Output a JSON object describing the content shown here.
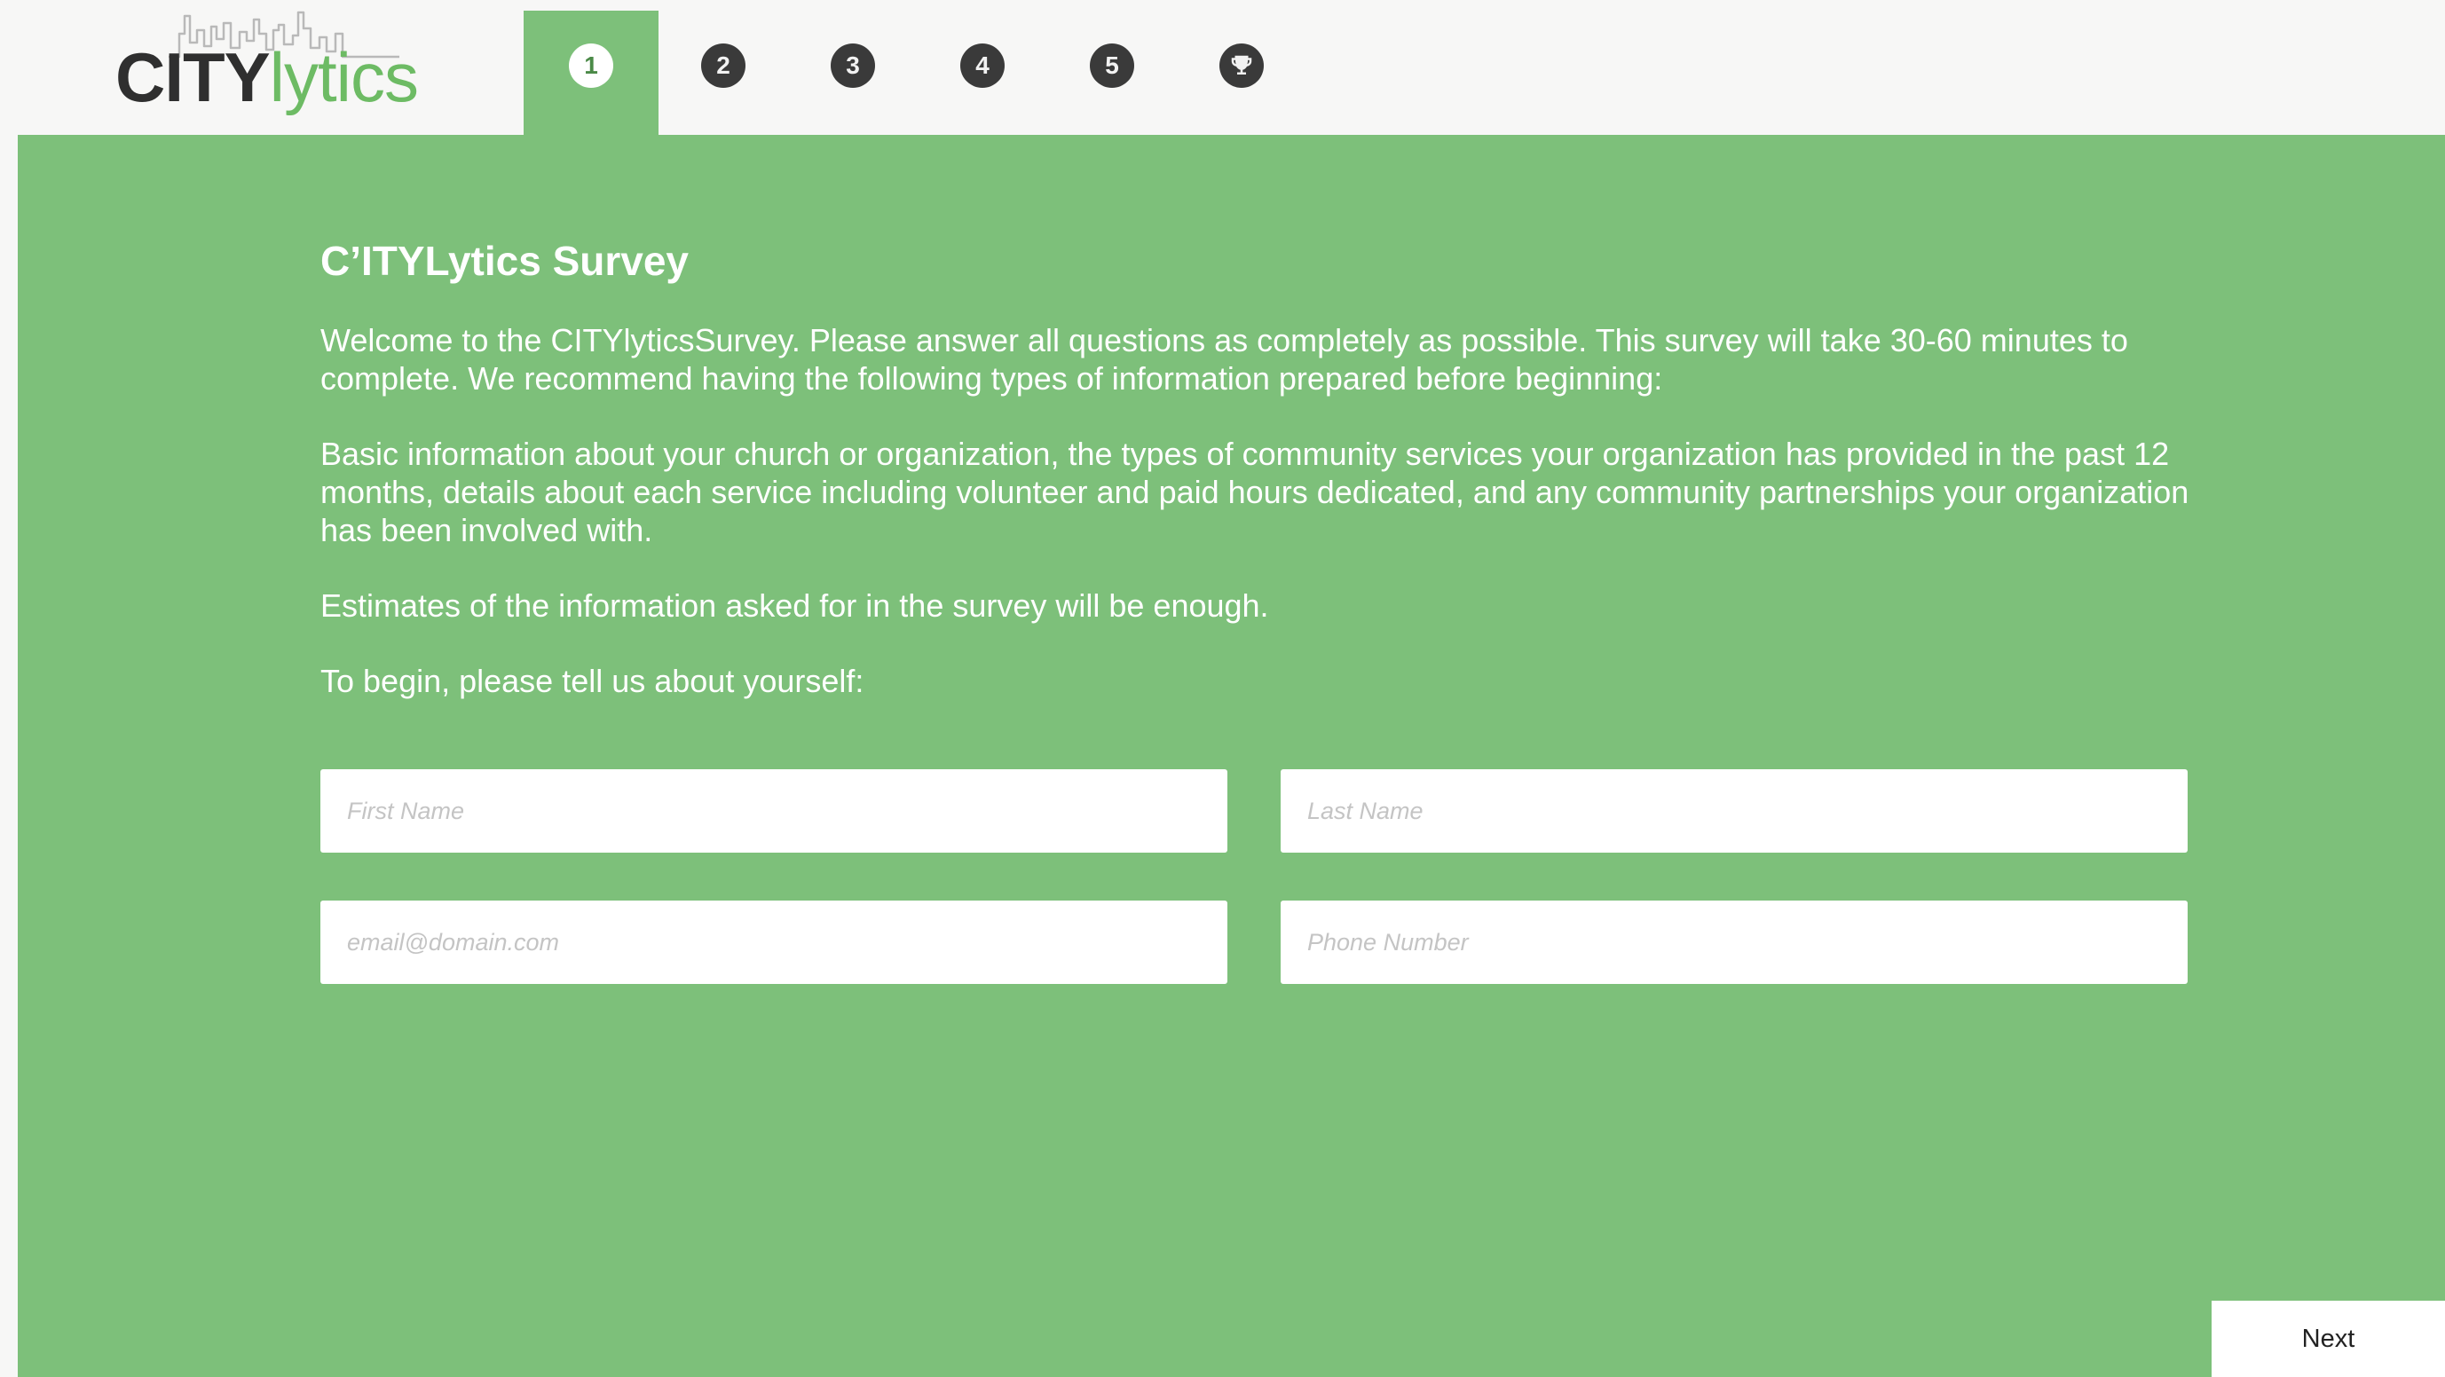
{
  "brand": {
    "name_part_1": "CITY",
    "name_part_2": "lytics",
    "primary_color": "#7dc07a",
    "logo_green": "#6dbb64",
    "logo_dark": "#2f2f2f"
  },
  "steps": [
    {
      "label": "1",
      "active": true
    },
    {
      "label": "2",
      "active": false
    },
    {
      "label": "3",
      "active": false
    },
    {
      "label": "4",
      "active": false
    },
    {
      "label": "5",
      "active": false
    },
    {
      "label": "",
      "icon": "trophy-icon",
      "active": false
    }
  ],
  "survey": {
    "title": "C’ITYLytics Survey",
    "paragraphs": [
      "Welcome to the CITYlyticsSurvey. Please answer all questions as completely as possible. This survey will take 30-60 minutes to complete. We recommend having the following types of information prepared before beginning:",
      "Basic information about your church or organization, the types of community services your organization has provided in the past 12 months, details about each service including volunteer and paid hours dedicated, and any community partnerships your organization has been involved with.",
      "Estimates of the information asked for in the survey will be enough.",
      "To begin, please tell us about yourself:"
    ]
  },
  "form": {
    "first_name": {
      "value": "",
      "placeholder": "First Name"
    },
    "last_name": {
      "value": "",
      "placeholder": "Last Name"
    },
    "email": {
      "value": "",
      "placeholder": "email@domain.com"
    },
    "phone": {
      "value": "",
      "placeholder": "Phone Number"
    }
  },
  "actions": {
    "next_label": "Next"
  }
}
